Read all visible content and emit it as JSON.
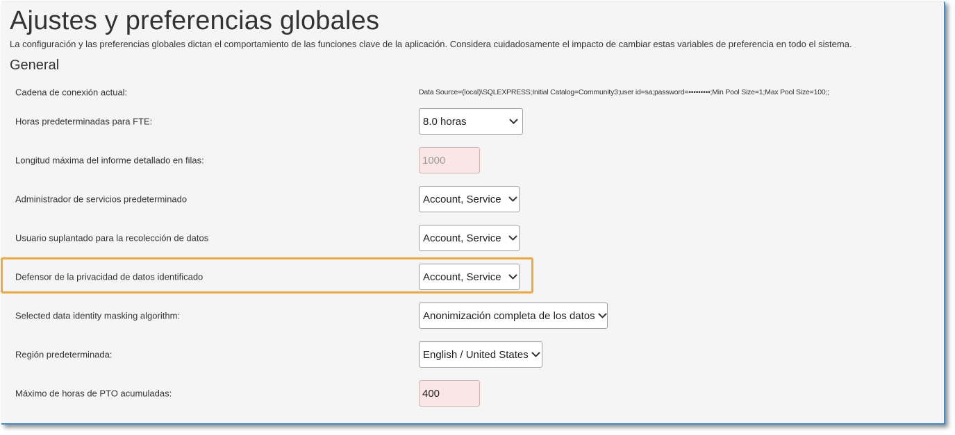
{
  "page": {
    "title": "Ajustes y preferencias globales",
    "description": "La configuración y las preferencias globales dictan el comportamiento de las funciones clave de la aplicación. Considera cuidadosamente el impacto de cambiar estas variables de preferencia en todo el sistema.",
    "section_title": "General"
  },
  "settings": {
    "connection": {
      "label": "Cadena de conexión actual:",
      "value": "Data Source=(local)\\SQLEXPRESS;Initial Catalog=Community3;user id=sa;password=•••••••••;Min Pool Size=1;Max Pool Size=100;;"
    },
    "fte_hours": {
      "label": "Horas predeterminadas para FTE:",
      "value": "8.0 horas"
    },
    "report_length": {
      "label": "Longitud máxima del informe detallado en filas:",
      "value": "1000"
    },
    "service_admin": {
      "label": "Administrador de servicios predeterminado",
      "value": "Account, Service"
    },
    "impersonated_user": {
      "label": "Usuario suplantado para la recolección de datos",
      "value": "Account, Service"
    },
    "privacy_champion": {
      "label": "Defensor de la privacidad de datos identificado",
      "value": "Account, Service"
    },
    "masking_algorithm": {
      "label": "Selected data identity masking algorithm:",
      "value": "Anonimización completa de los datos"
    },
    "region": {
      "label": "Región predeterminada:",
      "value": "English / United States"
    },
    "max_pto": {
      "label": "Máximo de horas de PTO acumuladas:",
      "value": "400"
    }
  },
  "icons": {
    "dropdown": "chevron-down-icon"
  },
  "colors": {
    "highlight": "#f0a93a",
    "panel_border": "#3d8fd1",
    "input_invalid_bg": "#fbe6e6"
  }
}
